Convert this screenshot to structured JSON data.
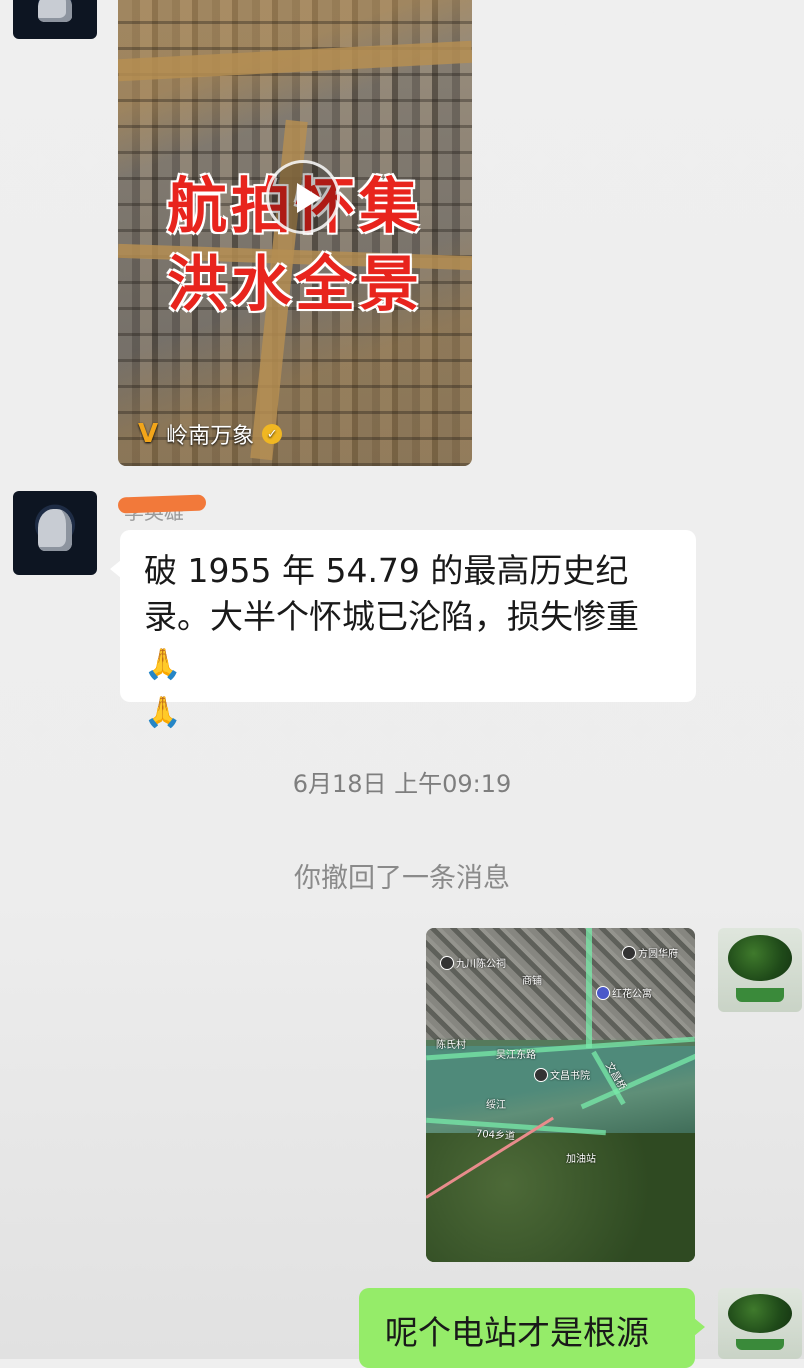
{
  "video_card": {
    "title_line1": "航拍怀集",
    "title_line2": "洪水全景",
    "brand_logo": "Ⅴ",
    "brand_name": "岭南万象",
    "verified_mark": "✓",
    "play_icon": "play-icon"
  },
  "incoming_message": {
    "sender_name": "李英雄",
    "text": "破 1955 年 54.79 的最高历史纪录。大半个怀城已沦陷，损失惨重",
    "emoji": "🙏"
  },
  "timestamp": "6月18日 上午09:19",
  "system_message": "你撤回了一条消息",
  "map_image": {
    "labels": {
      "ancestral_hall": "九川陈公祠",
      "residence": "方圆华府",
      "apartment": "红花公寓",
      "street": "吴江东路",
      "village": "陈氏村",
      "bookstore": "文昌书院",
      "bridge": "文昌桥",
      "road": "704乡道",
      "station": "加油站",
      "river": "绥江",
      "shop": "商铺"
    }
  },
  "outgoing_message": {
    "text": "呢个电站才是根源"
  },
  "colors": {
    "background": "#ededed",
    "incoming_bubble": "#ffffff",
    "outgoing_bubble": "#95ec69",
    "title_red": "#e8241d"
  }
}
